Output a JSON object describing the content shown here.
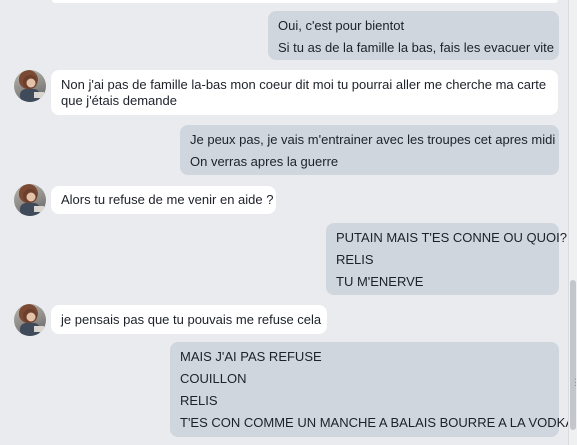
{
  "messages": [
    {
      "side": "out",
      "lines": [
        "Oui, c'est pour bientot",
        "Si tu as de la famille la bas, fais les evacuer vite"
      ]
    },
    {
      "side": "in",
      "lines": [
        "Non j'ai pas de famille la-bas mon coeur dit moi tu pourrai aller me cherche ma carte que j'étais demande"
      ]
    },
    {
      "side": "out",
      "lines": [
        "Je peux pas, je vais m'entrainer avec les troupes cet apres midi",
        "On verras apres la guerre"
      ]
    },
    {
      "side": "in",
      "lines": [
        "Alors tu refuse de me venir en aide ?"
      ]
    },
    {
      "side": "out",
      "lines": [
        "PUTAIN MAIS T'ES CONNE OU QUOI?",
        "RELIS",
        "TU M'ENERVE"
      ]
    },
    {
      "side": "in",
      "lines": [
        "je pensais pas que tu pouvais me refuse cela"
      ]
    },
    {
      "side": "out",
      "lines": [
        "MAIS J'AI PAS REFUSE",
        "COUILLON",
        "RELIS",
        "T'ES CON COMME UN MANCHE A BALAIS BOURRE A LA VODKA"
      ]
    }
  ],
  "icons": {
    "avatar": "contact-avatar-photo",
    "grip": "resize-grip-icon"
  },
  "colors": {
    "background": "#e9ebee",
    "outgoing": "#cfd6dd",
    "incoming": "#ffffff",
    "text": "#1d2129"
  }
}
